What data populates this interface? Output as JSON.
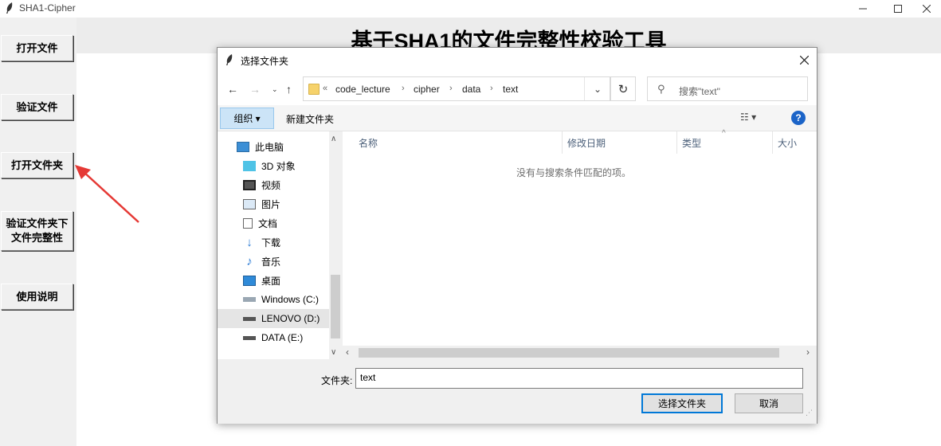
{
  "window": {
    "title": "SHA1-Cipher"
  },
  "sidebar": {
    "buttons": [
      {
        "label": "打开文件"
      },
      {
        "label": "验证文件"
      },
      {
        "label": "打开文件夹"
      },
      {
        "label": "验证文件夹下\n文件完整性"
      },
      {
        "label": "使用说明"
      }
    ]
  },
  "main": {
    "heading": "基于SHA1的文件完整性校验工具"
  },
  "dialog": {
    "title": "选择文件夹",
    "address": {
      "overflow": "«",
      "crumbs": [
        "code_lecture",
        "cipher",
        "data",
        "text"
      ]
    },
    "search_placeholder": "搜索\"text\"",
    "toolbar": {
      "organize": "组织 ▾",
      "new_folder": "新建文件夹"
    },
    "nav_items": [
      {
        "label": "此电脑",
        "icon": "computer-icon"
      },
      {
        "label": "3D 对象",
        "icon": "cube-icon"
      },
      {
        "label": "视频",
        "icon": "video-icon"
      },
      {
        "label": "图片",
        "icon": "picture-icon"
      },
      {
        "label": "文档",
        "icon": "document-icon"
      },
      {
        "label": "下载",
        "icon": "download-icon"
      },
      {
        "label": "音乐",
        "icon": "music-icon"
      },
      {
        "label": "桌面",
        "icon": "desktop-icon"
      },
      {
        "label": "Windows (C:)",
        "icon": "drive-icon"
      },
      {
        "label": "LENOVO (D:)",
        "icon": "drive-icon",
        "selected": true
      },
      {
        "label": "DATA (E:)",
        "icon": "drive-icon"
      }
    ],
    "columns": [
      "名称",
      "修改日期",
      "类型",
      "大小"
    ],
    "empty_message": "没有与搜索条件匹配的项。",
    "folder_label": "文件夹:",
    "folder_value": "text",
    "ok_label": "选择文件夹",
    "cancel_label": "取消"
  },
  "colors": {
    "accent": "#0078d7",
    "annotation_arrow": "#e53935"
  }
}
